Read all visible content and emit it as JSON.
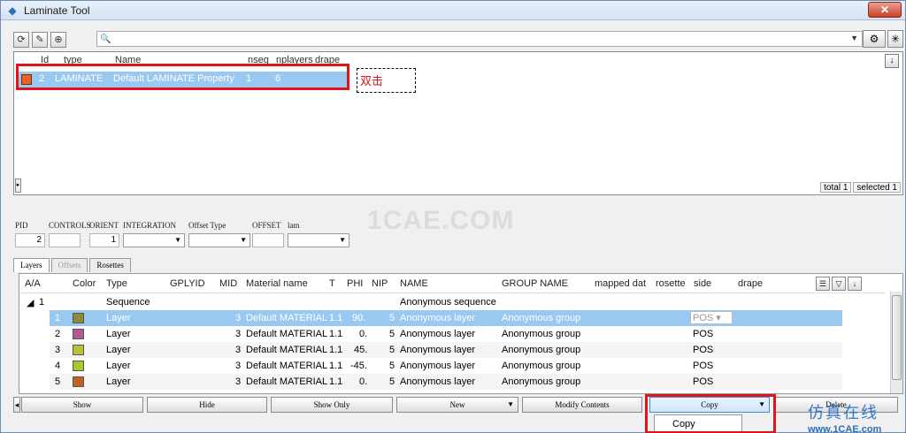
{
  "window": {
    "title": "Laminate Tool",
    "close_label": "✕"
  },
  "toolbar": {
    "search_value": "",
    "buttons": [
      "refresh-icon",
      "brush-icon",
      "zoom-icon"
    ]
  },
  "top_table": {
    "headers": [
      "Id",
      "type",
      "Name",
      "nseg",
      "nplayers",
      "drape"
    ],
    "row": {
      "id": "2",
      "type": "LAMINATE",
      "name": "Default LAMINATE Property",
      "nseg": "1",
      "nplayers": "6",
      "color": "#e8632a"
    },
    "status_total": "total 1",
    "status_selected": "selected 1"
  },
  "annotation": {
    "double_click": "双击"
  },
  "watermark": "1CAE.COM",
  "props": {
    "labels": [
      "PID",
      "CONTROLS",
      "ORIENT",
      "INTEGRATION",
      "Offset Type",
      "OFFSET",
      "lam"
    ],
    "pid": "2",
    "orient": "1"
  },
  "tabs": [
    "Layers",
    "Offsets",
    "Rosettes"
  ],
  "layers": {
    "headers": [
      "A/A",
      "Color",
      "Type",
      "GPLYID",
      "MID",
      "Material name",
      "T",
      "PHI",
      "NIP",
      "NAME",
      "GROUP NAME",
      "mapped dat",
      "rosette",
      "side",
      "drape"
    ],
    "sequence": {
      "aa": "1",
      "type": "Sequence",
      "name": "Anonymous sequence"
    },
    "rows": [
      {
        "aa": "1",
        "color": "#8a8a3a",
        "type": "Layer",
        "mid": "3",
        "material": "Default MATERIAL",
        "t": "1.1",
        "phi": "90.",
        "nip": "5",
        "name": "Anonymous layer",
        "group": "Anonymous group",
        "side": "POS"
      },
      {
        "aa": "2",
        "color": "#b05a9a",
        "type": "Layer",
        "mid": "3",
        "material": "Default MATERIAL",
        "t": "1.1",
        "phi": "0.",
        "nip": "5",
        "name": "Anonymous layer",
        "group": "Anonymous group",
        "side": "POS"
      },
      {
        "aa": "3",
        "color": "#b8c434",
        "type": "Layer",
        "mid": "3",
        "material": "Default MATERIAL",
        "t": "1.1",
        "phi": "45.",
        "nip": "5",
        "name": "Anonymous layer",
        "group": "Anonymous group",
        "side": "POS"
      },
      {
        "aa": "4",
        "color": "#a8c82a",
        "type": "Layer",
        "mid": "3",
        "material": "Default MATERIAL",
        "t": "1.1",
        "phi": "-45.",
        "nip": "5",
        "name": "Anonymous layer",
        "group": "Anonymous group",
        "side": "POS"
      },
      {
        "aa": "5",
        "color": "#c2621e",
        "type": "Layer",
        "mid": "3",
        "material": "Default MATERIAL",
        "t": "1.1",
        "phi": "0.",
        "nip": "5",
        "name": "Anonymous layer",
        "group": "Anonymous group",
        "side": "POS"
      }
    ]
  },
  "buttons": {
    "show": "Show",
    "hide": "Hide",
    "show_only": "Show Only",
    "new": "New",
    "modify": "Modify Contents",
    "copy": "Copy",
    "delete": "Delete"
  },
  "copy_menu": {
    "item": "Copy"
  },
  "brand": {
    "line1": "仿真在线",
    "line2": "www.1CAE.com"
  }
}
